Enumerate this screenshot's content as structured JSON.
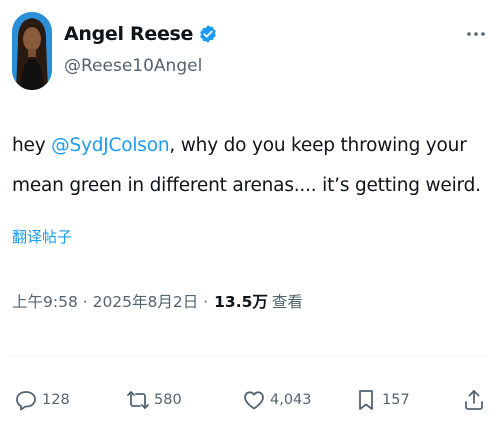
{
  "author": {
    "display_name": "Angel Reese",
    "handle": "@Reese10Angel"
  },
  "tweet": {
    "text_before": "hey ",
    "mention": "@SydJColson",
    "text_after": ",  why do you keep throwing your mean green in different arenas.... it’s getting weird."
  },
  "translate_label": "翻译帖子",
  "meta": {
    "timestamp": "上午9:58 · 2025年8月2日 ·",
    "views_count": "13.5万",
    "views_label": "查看"
  },
  "actions": {
    "replies": "128",
    "reposts": "580",
    "likes": "4,043",
    "bookmarks": "157"
  },
  "colors": {
    "accent": "#1d9bf0",
    "text": "#0f1419",
    "secondary": "#536471"
  },
  "icons": [
    "verified-badge-icon",
    "more-icon",
    "reply-icon",
    "repost-icon",
    "like-icon",
    "bookmark-icon",
    "share-icon"
  ]
}
